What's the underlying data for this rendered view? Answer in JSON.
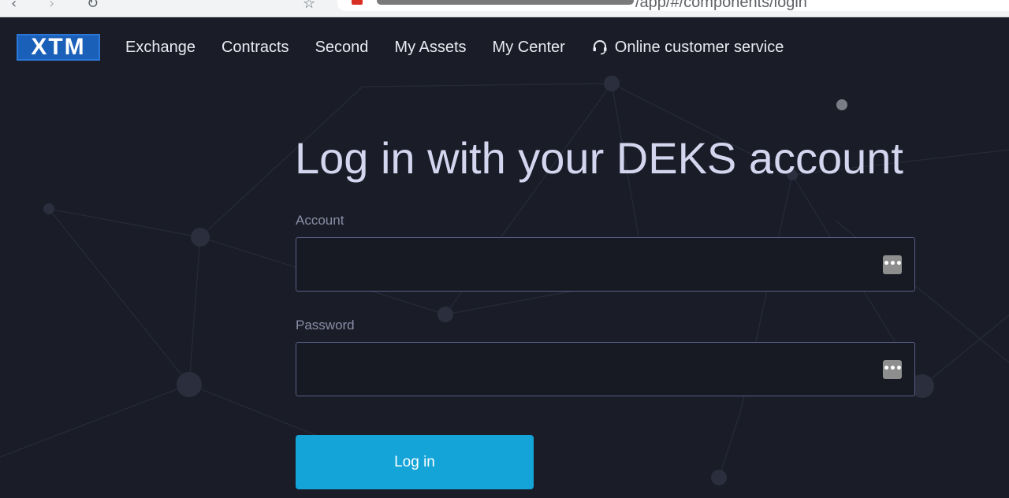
{
  "browser": {
    "url_visible": "/app/#/components/login"
  },
  "nav": {
    "logo": "XTM",
    "items": [
      "Exchange",
      "Contracts",
      "Second",
      "My Assets",
      "My Center"
    ],
    "customer_service": "Online customer service"
  },
  "login": {
    "title": "Log in with your DEKS account",
    "account_label": "Account",
    "account_value": "",
    "password_label": "Password",
    "password_value": "",
    "button_label": "Log in"
  },
  "colors": {
    "background": "#1a1d27",
    "accent": "#14a4d8",
    "logo_blue": "#1a5fb8",
    "nav_text": "#e9eaf2",
    "title_text": "#d4d6f0"
  },
  "icons": {
    "customer_service": "headset-icon",
    "password_manager": "key-dots-icon"
  }
}
